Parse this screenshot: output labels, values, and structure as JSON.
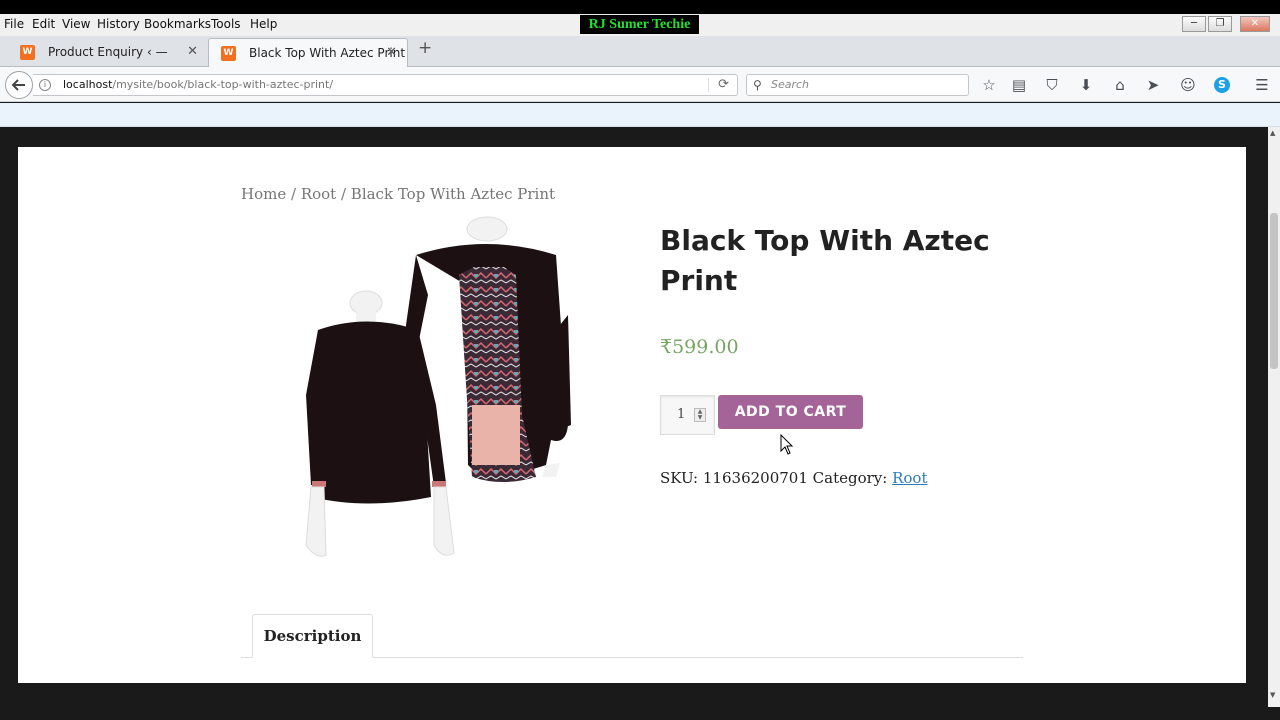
{
  "overlay": {
    "channel": "RJ Sumer Techie"
  },
  "menubar": {
    "items": [
      "File",
      "Edit",
      "View",
      "History",
      "Bookmarks",
      "Tools",
      "Help"
    ]
  },
  "window_controls": {
    "minimize": "─",
    "restore": "❐",
    "close": "✕"
  },
  "tabs": [
    {
      "title": "Product Enquiry ‹ — Word...",
      "active": false,
      "close": "✕",
      "icon": "wordpress-favicon"
    },
    {
      "title": "Black Top With Aztec Print",
      "active": true,
      "close": "✕",
      "icon": "wordpress-favicon"
    }
  ],
  "new_tab": "+",
  "navbar": {
    "back": "🡐",
    "url_host": "localhost",
    "url_path": "/mysite/book/black-top-with-aztec-print/",
    "reload": "⟳",
    "search_placeholder": "Search",
    "toolbar_icons": [
      "star-icon",
      "reading-list-icon",
      "pocket-icon",
      "download-icon",
      "home-icon",
      "send-icon",
      "chat-icon",
      "skype-icon",
      "menu-icon"
    ]
  },
  "breadcrumb": {
    "home": "Home",
    "sep1": " / ",
    "root": "Root",
    "sep2": " / ",
    "current": "Black Top With Aztec Print"
  },
  "product": {
    "title": "Black Top With Aztec Print",
    "price": "₹599.00",
    "quantity": "1",
    "add_to_cart": "ADD TO CART",
    "sku_label": "SKU:",
    "sku": "11636200701",
    "category_label": "Category:",
    "category": "Root"
  },
  "product_tabs": {
    "description": "Description"
  },
  "colors": {
    "accent_button": "#a46497",
    "price": "#77a464",
    "link": "#2b7bb9"
  }
}
